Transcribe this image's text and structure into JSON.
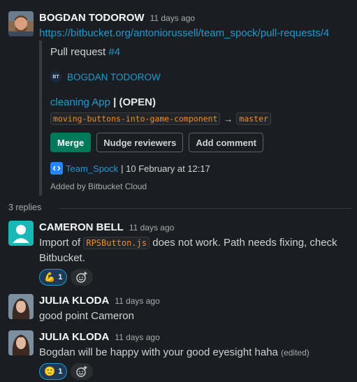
{
  "parent": {
    "author": "BOGDAN TODOROW",
    "time": "11 days ago",
    "link": "https://bitbucket.org/antoniorussell/team_spock/pull-requests/4"
  },
  "attachment": {
    "pr_label": "Pull request",
    "pr_number": "#4",
    "badge": "BT",
    "pr_author": "BOGDAN TODOROW",
    "app_name": "cleaning App",
    "status": "| (OPEN)",
    "source_branch": "moving-buttons-into-game-component",
    "arrow": "→",
    "target_branch": "master",
    "buttons": {
      "merge": "Merge",
      "nudge": "Nudge reviewers",
      "comment": "Add comment"
    },
    "repo": "Team_Spock",
    "date": "| 10 February at 12:17",
    "added_by": "Added by Bitbucket Cloud"
  },
  "replies_count": "3 replies",
  "replies": [
    {
      "author": "CAMERON BELL",
      "time": "11 days ago",
      "text_before": "Import of",
      "code": "RPSButton.js",
      "text_after": "does not work. Path needs fixing, check Bitbucket.",
      "reaction_emoji": "💪",
      "reaction_count": "1"
    },
    {
      "author": "JULIA KLODA",
      "time": "11 days ago",
      "text": "good point Cameron"
    },
    {
      "author": "JULIA KLODA",
      "time": "11 days ago",
      "text": "Bogdan will be happy with your good eyesight haha",
      "edited": "(edited)",
      "reaction_emoji": "🙂",
      "reaction_count": "1"
    }
  ],
  "colors": {
    "background": "#1a1d21",
    "link": "#1d9bd1",
    "merge_button": "#007a5a",
    "code": "#e8912d"
  }
}
